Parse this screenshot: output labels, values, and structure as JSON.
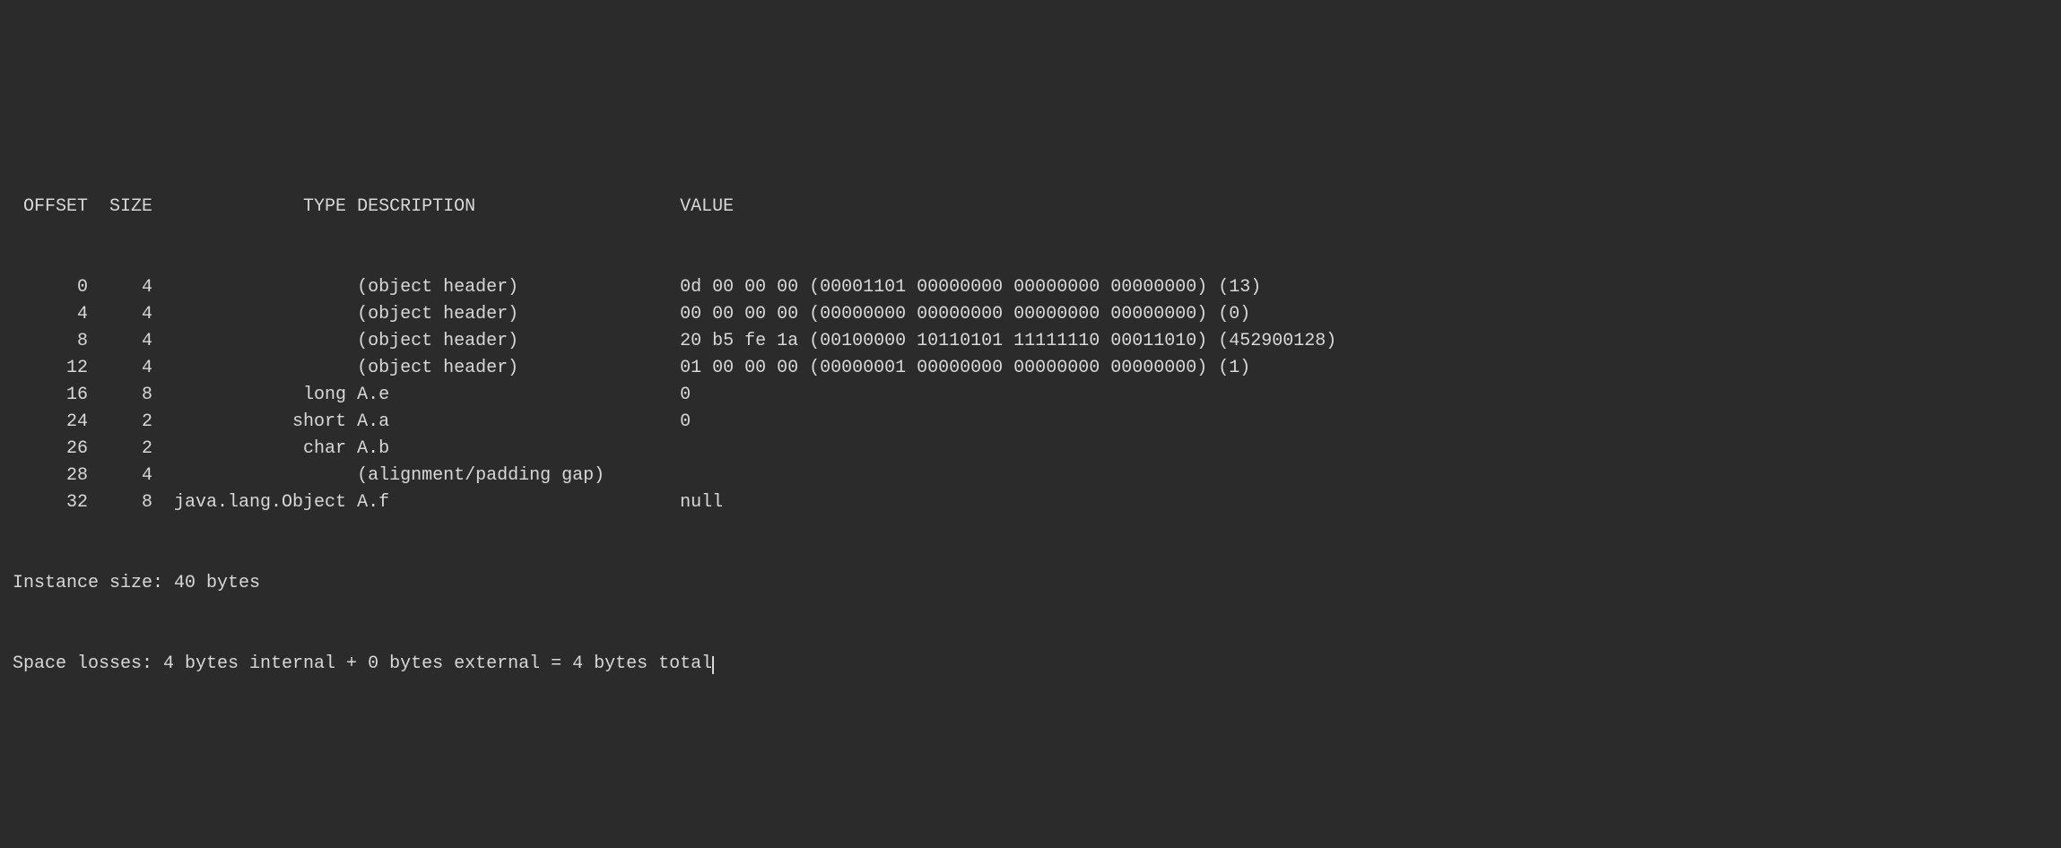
{
  "widths": {
    "offset": 7,
    "size": 5,
    "type": 17,
    "descgap": 30
  },
  "header": {
    "offset": "OFFSET",
    "size": "SIZE",
    "type": "TYPE",
    "description": "DESCRIPTION",
    "value": "VALUE"
  },
  "rows": [
    {
      "offset": "0",
      "size": "4",
      "type": "",
      "description": "(object header)",
      "value": "0d 00 00 00 (00001101 00000000 00000000 00000000) (13)"
    },
    {
      "offset": "4",
      "size": "4",
      "type": "",
      "description": "(object header)",
      "value": "00 00 00 00 (00000000 00000000 00000000 00000000) (0)"
    },
    {
      "offset": "8",
      "size": "4",
      "type": "",
      "description": "(object header)",
      "value": "20 b5 fe 1a (00100000 10110101 11111110 00011010) (452900128)"
    },
    {
      "offset": "12",
      "size": "4",
      "type": "",
      "description": "(object header)",
      "value": "01 00 00 00 (00000001 00000000 00000000 00000000) (1)"
    },
    {
      "offset": "16",
      "size": "8",
      "type": "long",
      "description": "A.e",
      "value": "0"
    },
    {
      "offset": "24",
      "size": "2",
      "type": "short",
      "description": "A.a",
      "value": "0"
    },
    {
      "offset": "26",
      "size": "2",
      "type": "char",
      "description": "A.b",
      "value": ""
    },
    {
      "offset": "28",
      "size": "4",
      "type": "",
      "description": "(alignment/padding gap)",
      "value": ""
    },
    {
      "offset": "32",
      "size": "8",
      "type": "java.lang.Object",
      "description": "A.f",
      "value": "null"
    }
  ],
  "footer": {
    "instance_size": "Instance size: 40 bytes",
    "space_losses": "Space losses: 4 bytes internal + 0 bytes external = 4 bytes total"
  }
}
